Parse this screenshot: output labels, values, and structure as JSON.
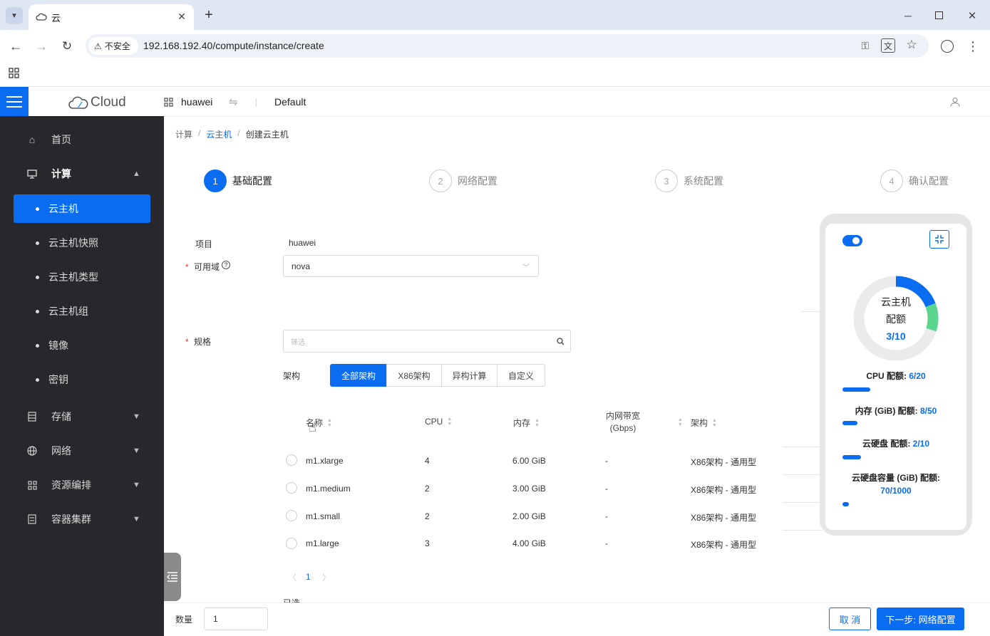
{
  "browser": {
    "tab_title": "云",
    "security_label": "不安全",
    "url": "192.168.192.40/compute/instance/create"
  },
  "header": {
    "logo_text": "Cloud",
    "project": "huawei",
    "domain": "Default"
  },
  "sidebar": {
    "home": "首页",
    "compute": "计算",
    "compute_items": [
      "云主机",
      "云主机快照",
      "云主机类型",
      "云主机组",
      "镜像",
      "密钥"
    ],
    "storage": "存储",
    "network": "网络",
    "orchestration": "资源编排",
    "container": "容器集群"
  },
  "breadcrumb": {
    "level1": "计算",
    "sep": "/",
    "level2": "云主机",
    "current": "创建云主机"
  },
  "steps": [
    {
      "num": "1",
      "label": "基础配置"
    },
    {
      "num": "2",
      "label": "网络配置"
    },
    {
      "num": "3",
      "label": "系统配置"
    },
    {
      "num": "4",
      "label": "确认配置"
    }
  ],
  "form": {
    "project_label": "项目",
    "project_value": "huawei",
    "az_label": "可用域",
    "az_value": "nova",
    "flavor_label": "规格",
    "filter_placeholder": "筛选",
    "arch_label": "架构",
    "arch_tabs": [
      "全部架构",
      "X86架构",
      "异构计算",
      "自定义"
    ],
    "count_label": "数量",
    "count_value": "1",
    "partial_label": "已选"
  },
  "table": {
    "headers": {
      "name": "名称",
      "cpu": "CPU",
      "mem": "内存",
      "bw1": "内网带宽",
      "bw2": "(Gbps)",
      "arch": "架构"
    },
    "rows": [
      {
        "name": "m1.xlarge",
        "cpu": "4",
        "mem": "6.00 GiB",
        "bw": "-",
        "arch": "X86架构 - 通用型"
      },
      {
        "name": "m1.medium",
        "cpu": "2",
        "mem": "3.00 GiB",
        "bw": "-",
        "arch": "X86架构 - 通用型"
      },
      {
        "name": "m1.small",
        "cpu": "2",
        "mem": "2.00 GiB",
        "bw": "-",
        "arch": "X86架构 - 通用型"
      },
      {
        "name": "m1.large",
        "cpu": "3",
        "mem": "4.00 GiB",
        "bw": "-",
        "arch": "X86架构 - 通用型"
      }
    ],
    "page": "1"
  },
  "quota": {
    "ring_line1": "云主机",
    "ring_line2": "配额",
    "ring_value": "3/10",
    "ring_used_fraction": 0.3,
    "cpu_label": "CPU 配额: ",
    "cpu_value": "6/20",
    "cpu_fraction": 0.3,
    "mem_label": "内存 (GiB) 配额: ",
    "mem_value": "8/50",
    "mem_fraction": 0.16,
    "disk_label": "云硬盘 配额: ",
    "disk_value": "2/10",
    "disk_fraction": 0.2,
    "cap_label": "云硬盘容量 (GiB) 配额:",
    "cap_value": "70/1000",
    "cap_fraction": 0.07
  },
  "footer": {
    "cancel": "取 消",
    "next": "下一步: 网络配置"
  },
  "colors": {
    "primary": "#0a6cf0",
    "sidebar_bg": "#27282b",
    "ring_new": "#5ad68f"
  }
}
